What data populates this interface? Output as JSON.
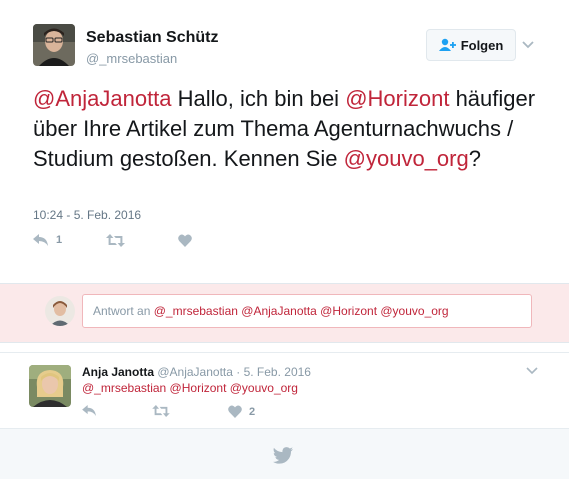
{
  "tweet": {
    "author_name": "Sebastian Schütz",
    "author_handle": "@_mrsebastian",
    "follow_label": "Folgen",
    "text_parts": [
      {
        "type": "mention",
        "text": "@AnjaJanotta"
      },
      {
        "type": "text",
        "text": " Hallo, ich bin bei "
      },
      {
        "type": "mention",
        "text": "@Horizont"
      },
      {
        "type": "text",
        "text": " häufiger über Ihre Artikel zum Thema Agenturnachwuchs / Studium gestoßen. Kennen Sie "
      },
      {
        "type": "mention",
        "text": "@youvo_org"
      },
      {
        "type": "text",
        "text": "?"
      }
    ],
    "timestamp": "10:24 - 5. Feb. 2016",
    "reply_count": "1",
    "retweet_count": "",
    "like_count": ""
  },
  "reply_box": {
    "prefix": "Antwort an ",
    "mentions": "@_mrsebastian @AnjaJanotta @Horizont @youvo_org"
  },
  "reply_tweet": {
    "author_name": "Anja Janotta",
    "meta": "@AnjaJanotta · 5. Feb. 2016",
    "text": "@_mrsebastian @Horizont @youvo_org",
    "reply_count": "",
    "retweet_count": "",
    "like_count": "2"
  },
  "colors": {
    "accent": "#c0253a",
    "icon_gray": "#aab8c2",
    "reply_bg": "#fbe9ea"
  },
  "icons": [
    "add-user-icon",
    "chevron-down-icon",
    "reply-icon",
    "retweet-icon",
    "heart-icon",
    "twitter-bird-icon"
  ]
}
